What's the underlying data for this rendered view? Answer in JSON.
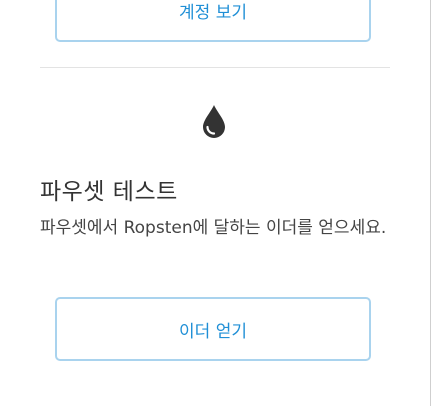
{
  "account_section": {
    "view_account_label": "계정 보기"
  },
  "faucet_section": {
    "icon": "drop-icon",
    "title": "파우셋 테스트",
    "description": "파우셋에서 Ropsten에 달하는 이더를 얻으세요.",
    "get_ether_label": "이더 얻기"
  },
  "colors": {
    "accent": "#1f8fd6",
    "button_border": "#a9d3ee",
    "icon": "#333333"
  }
}
